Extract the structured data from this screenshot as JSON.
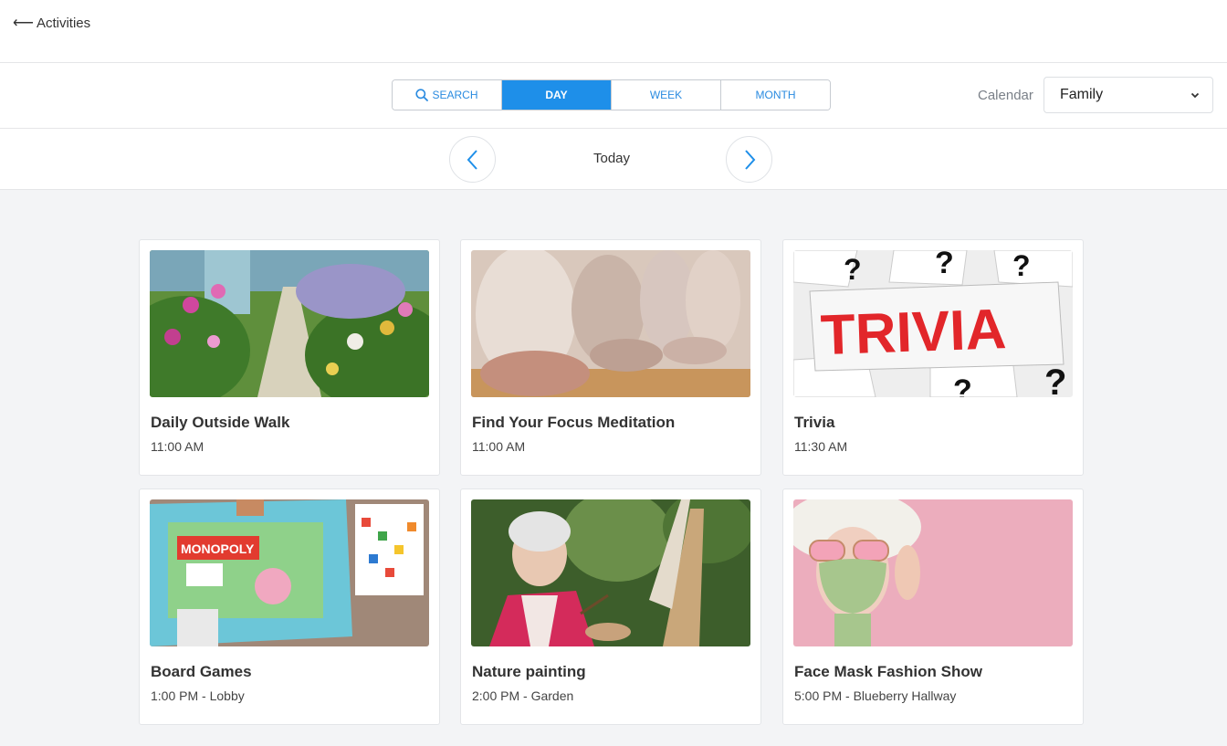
{
  "header": {
    "back_label": "Activities"
  },
  "view_tabs": [
    {
      "label": "SEARCH",
      "icon": "search-icon",
      "active": false
    },
    {
      "label": "DAY",
      "active": true
    },
    {
      "label": "WEEK",
      "active": false
    },
    {
      "label": "MONTH",
      "active": false
    }
  ],
  "calendar": {
    "label": "Calendar",
    "selected": "Family"
  },
  "date_nav": {
    "label": "Today"
  },
  "activities": [
    {
      "title": "Daily Outside Walk",
      "time": "11:00 AM",
      "image": "garden-path-photo"
    },
    {
      "title": "Find Your Focus Meditation",
      "time": "11:00 AM",
      "image": "meditation-photo"
    },
    {
      "title": "Trivia",
      "time": "11:30 AM",
      "image": "trivia-photo"
    },
    {
      "title": "Board Games",
      "time": "1:00 PM - Lobby",
      "image": "board-game-photo"
    },
    {
      "title": "Nature painting",
      "time": "2:00 PM - Garden",
      "image": "painting-photo"
    },
    {
      "title": "Face Mask Fashion Show",
      "time": "5:00 PM - Blueberry Hallway",
      "image": "face-mask-photo"
    }
  ],
  "colors": {
    "accent": "#1e8fe9",
    "background": "#f3f4f6"
  }
}
